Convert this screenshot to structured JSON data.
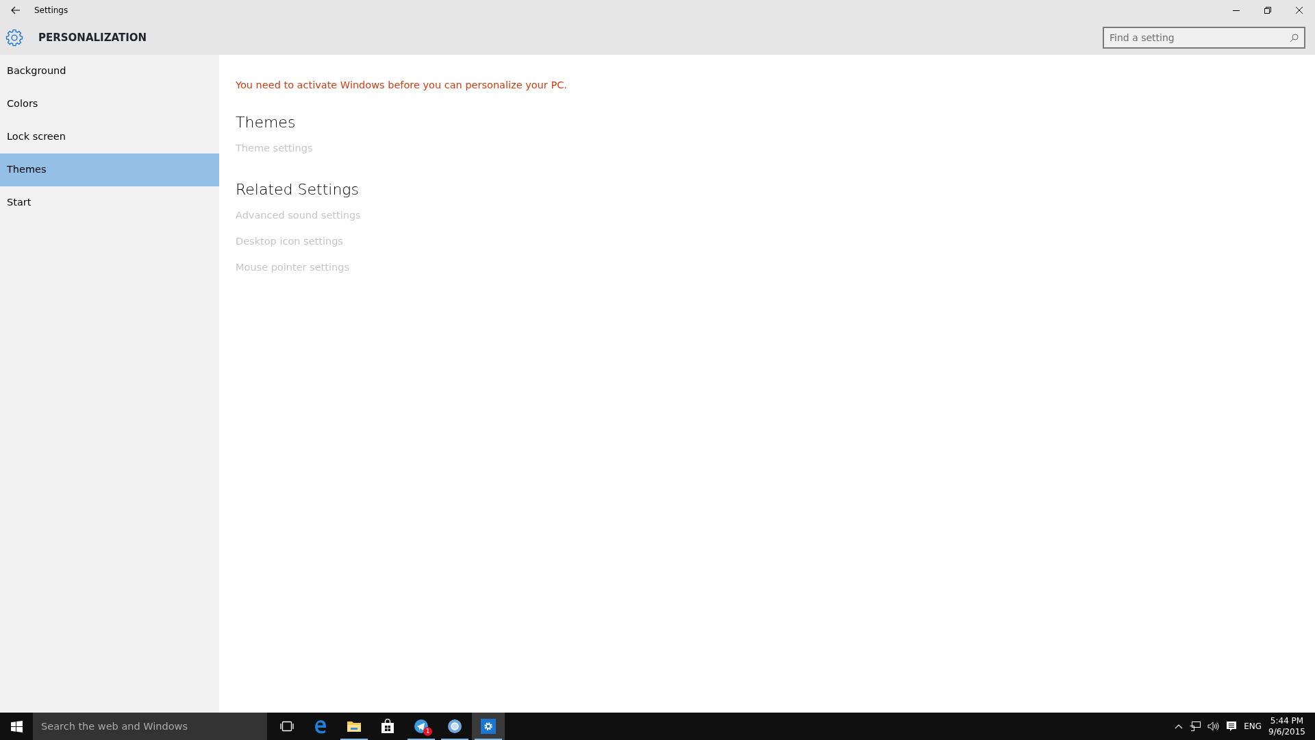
{
  "window": {
    "title": "Settings"
  },
  "header": {
    "title": "PERSONALIZATION",
    "search": {
      "placeholder": "Find a setting"
    }
  },
  "sidebar": {
    "items": [
      {
        "label": "Background",
        "selected": false
      },
      {
        "label": "Colors",
        "selected": false
      },
      {
        "label": "Lock screen",
        "selected": false
      },
      {
        "label": "Themes",
        "selected": true
      },
      {
        "label": "Start",
        "selected": false
      }
    ]
  },
  "content": {
    "notice": "You need to activate Windows before you can personalize your PC.",
    "sections": [
      {
        "heading": "Themes",
        "links": [
          {
            "label": "Theme settings",
            "disabled": true
          }
        ]
      },
      {
        "heading": "Related Settings",
        "links": [
          {
            "label": "Advanced sound settings",
            "disabled": true
          },
          {
            "label": "Desktop icon settings",
            "disabled": true
          },
          {
            "label": "Mouse pointer settings",
            "disabled": true
          }
        ]
      }
    ]
  },
  "taskbar": {
    "search": {
      "placeholder": "Search the web and Windows"
    },
    "apps": [
      {
        "kind": "taskview",
        "running": false,
        "active": false
      },
      {
        "kind": "edge",
        "running": false,
        "active": false
      },
      {
        "kind": "explorer",
        "running": true,
        "active": false
      },
      {
        "kind": "store",
        "running": false,
        "active": false
      },
      {
        "kind": "messenger",
        "running": true,
        "active": false,
        "badge": "1"
      },
      {
        "kind": "browser",
        "running": true,
        "active": false
      },
      {
        "kind": "settings",
        "running": true,
        "active": true
      }
    ],
    "tray": {
      "language": "ENG",
      "time": "5:44 PM",
      "date": "9/6/2015"
    }
  }
}
